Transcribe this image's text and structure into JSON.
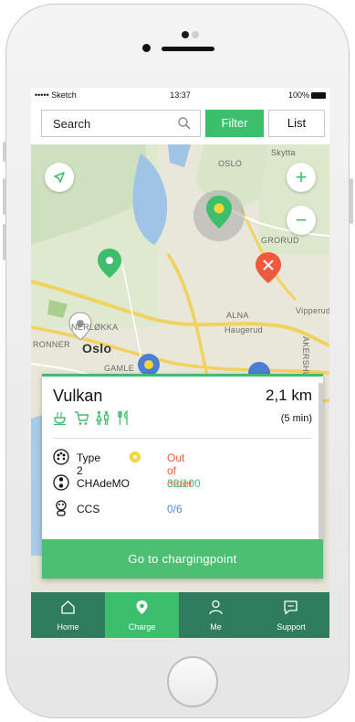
{
  "status_bar": {
    "carrier": "••••• Sketch",
    "time": "13:37",
    "battery": "100%"
  },
  "topbar": {
    "search_placeholder": "Search",
    "filter_label": "Filter",
    "list_label": "List"
  },
  "map": {
    "labels": [
      "Oslo",
      "ALNA",
      "Haugerud",
      "Vipperud",
      "Skytta",
      "GRORUD",
      "OSLO",
      "NERLØKKA",
      "GAMLE",
      "AKERSHUS",
      "RONNER"
    ],
    "zoom_in": "+",
    "zoom_out": "−"
  },
  "station": {
    "name": "Vulkan",
    "distance": "2,1 km",
    "duration": "(5 min)",
    "amenities": [
      "cafe-icon",
      "shopping-cart-icon",
      "toilet-icon",
      "restaurant-icon"
    ],
    "connectors": [
      {
        "type": "Type 2",
        "status": "Out of order",
        "status_color": "#ef5a3c",
        "warning": true
      },
      {
        "type": "CHAdeMO",
        "status": "32/100",
        "status_color": "#46c17b",
        "warning": false
      },
      {
        "type": "CCS",
        "status": "0/6",
        "status_color": "#4a90d9",
        "warning": false
      }
    ],
    "action_label": "Go to chargingpoint"
  },
  "tabs": [
    {
      "label": "Home",
      "icon": "home-icon",
      "active": false
    },
    {
      "label": "Charge",
      "icon": "location-pin-icon",
      "active": true
    },
    {
      "label": "Me",
      "icon": "user-icon",
      "active": false
    },
    {
      "label": "Support",
      "icon": "chat-icon",
      "active": false
    }
  ],
  "colors": {
    "accent": "#3dbe6c",
    "tabbar": "#2f7d5e",
    "alert": "#ef5a3c"
  }
}
